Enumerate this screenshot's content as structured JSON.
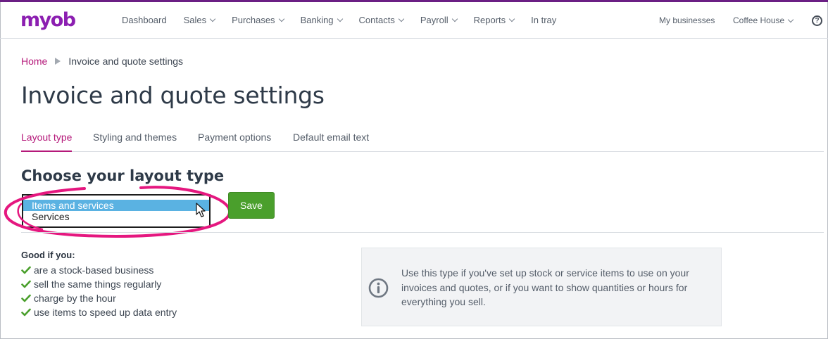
{
  "header": {
    "logo": "myob",
    "nav": [
      {
        "label": "Dashboard",
        "dropdown": false
      },
      {
        "label": "Sales",
        "dropdown": true
      },
      {
        "label": "Purchases",
        "dropdown": true
      },
      {
        "label": "Banking",
        "dropdown": true
      },
      {
        "label": "Contacts",
        "dropdown": true
      },
      {
        "label": "Payroll",
        "dropdown": true
      },
      {
        "label": "Reports",
        "dropdown": true
      },
      {
        "label": "In tray",
        "dropdown": false
      }
    ],
    "my_businesses": "My businesses",
    "business_name": "Coffee House",
    "help_label": "?"
  },
  "breadcrumb": {
    "home": "Home",
    "current": "Invoice and quote settings"
  },
  "page_title": "Invoice and quote settings",
  "tabs": [
    {
      "label": "Layout type",
      "active": true
    },
    {
      "label": "Styling and themes",
      "active": false
    },
    {
      "label": "Payment options",
      "active": false
    },
    {
      "label": "Default email text",
      "active": false
    }
  ],
  "layout": {
    "section_title": "Choose your layout type",
    "options": [
      {
        "label": "Items and services",
        "selected": true
      },
      {
        "label": "Services",
        "selected": false
      }
    ],
    "save_label": "Save"
  },
  "good_if": {
    "heading": "Good if you:",
    "items": [
      "are a stock-based business",
      "sell the same things regularly",
      "charge by the hour",
      "use items to speed up data entry"
    ]
  },
  "info": {
    "icon": "info-icon",
    "text": "Use this type if you've set up stock or service items to use on your invoices and quotes, or if you want to show quantities or hours for everything you sell."
  },
  "colors": {
    "brand": "#8c1fb1",
    "accent": "#b5197a",
    "save": "#4a9f2c",
    "selected": "#5ab2e2",
    "check": "#4a9f2c"
  }
}
